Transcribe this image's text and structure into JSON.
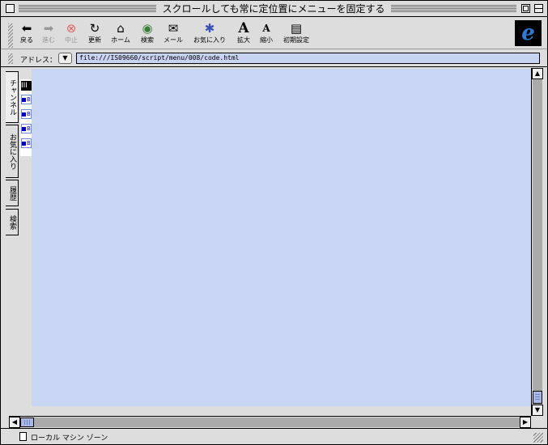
{
  "window": {
    "title": "スクロールしても常に定位置にメニューを固定する"
  },
  "toolbar": {
    "back": "戻る",
    "forward": "進む",
    "stop": "中止",
    "refresh": "更新",
    "home": "ホーム",
    "search": "検索",
    "mail": "メール",
    "favorites": "お気に入り",
    "larger": "拡大",
    "smaller": "縮小",
    "preferences": "初期設定"
  },
  "address": {
    "label": "アドレス：",
    "url": "file:///IS09660/script/menu/008/code.html"
  },
  "sidebar_tabs": [
    "チャンネル",
    "お気に入り",
    "履歴",
    "検索"
  ],
  "page": {
    "menu_head": "III",
    "menu_items": [
      "B",
      "B",
      "B",
      "B"
    ]
  },
  "status": {
    "zone": "ローカル マシン ゾーン"
  },
  "colors": {
    "page_bg": "#c8d6f4",
    "chrome": "#dddddd",
    "address_bg": "#c7d3f0"
  },
  "icons": {
    "back": "back-arrow-icon",
    "forward": "forward-arrow-icon",
    "stop": "stop-icon",
    "refresh": "refresh-icon",
    "home": "home-icon",
    "search": "search-icon",
    "mail": "mail-icon",
    "favorites": "favorites-icon",
    "larger": "text-larger-icon",
    "smaller": "text-smaller-icon",
    "preferences": "preferences-icon"
  }
}
